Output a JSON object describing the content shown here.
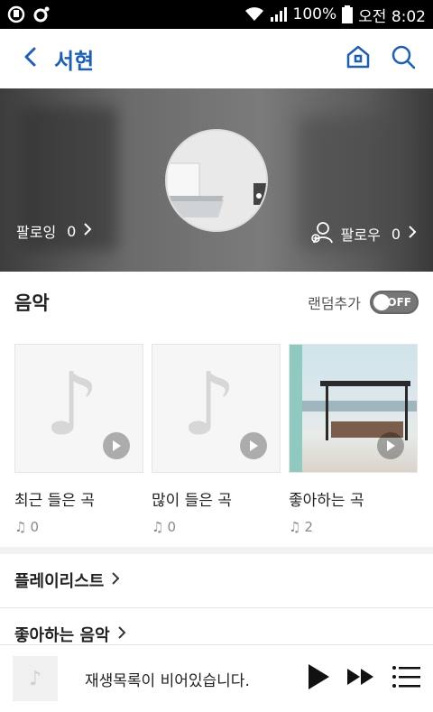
{
  "status": {
    "battery": "100%",
    "time": "오전 8:02"
  },
  "header": {
    "title": "서현",
    "icons": [
      "chevron-left-icon",
      "home-icon",
      "search-icon"
    ]
  },
  "profile": {
    "following_label": "팔로잉",
    "following_count": "0",
    "followers_label": "팔로우",
    "followers_count": "0"
  },
  "music": {
    "title": "음악",
    "random_add_label": "랜덤추가",
    "toggle_state": "OFF",
    "cards": [
      {
        "label": "최근 들은 곡",
        "count": "0"
      },
      {
        "label": "많이 들은 곡",
        "count": "0"
      },
      {
        "label": "좋아하는 곡",
        "count": "2"
      }
    ]
  },
  "lists": {
    "playlists": "플레이리스트",
    "liked_music": "좋아하는 음악"
  },
  "player": {
    "empty_message": "재생목록이 비어있습니다."
  },
  "colors": {
    "accent": "#1f5fb0",
    "status_bar": "#000000"
  }
}
